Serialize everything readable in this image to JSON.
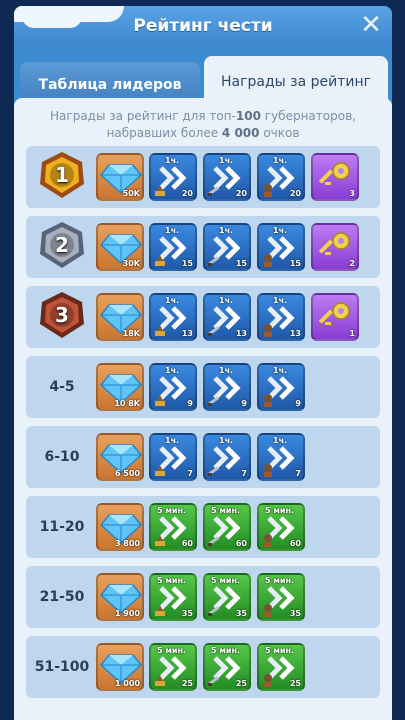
{
  "window": {
    "title": "Рейтинг чести",
    "close_icon": "close-icon"
  },
  "tabs": [
    {
      "label": "Таблица лидеров",
      "active": false
    },
    {
      "label": "Награды за рейтинг",
      "active": true
    }
  ],
  "intro": {
    "line1_prefix": "Награды за рейтинг для топ-",
    "line1_bold": "100",
    "line1_suffix": " губернаторов,",
    "line2_prefix": "набравших более ",
    "line2_bold": "4 000",
    "line2_suffix": " очков"
  },
  "rows": [
    {
      "rank": "1",
      "rank_icon": "gold-badge-icon",
      "gems": "50K",
      "boosts": [
        {
          "time": "1ч.",
          "qty": "20",
          "kind": "construction"
        },
        {
          "time": "1ч.",
          "qty": "20",
          "kind": "training"
        },
        {
          "time": "1ч.",
          "qty": "20",
          "kind": "research"
        }
      ],
      "key": "3"
    },
    {
      "rank": "2",
      "rank_icon": "silver-badge-icon",
      "gems": "30K",
      "boosts": [
        {
          "time": "1ч.",
          "qty": "15",
          "kind": "construction"
        },
        {
          "time": "1ч.",
          "qty": "15",
          "kind": "training"
        },
        {
          "time": "1ч.",
          "qty": "15",
          "kind": "research"
        }
      ],
      "key": "2"
    },
    {
      "rank": "3",
      "rank_icon": "bronze-badge-icon",
      "gems": "18K",
      "boosts": [
        {
          "time": "1ч.",
          "qty": "13",
          "kind": "construction"
        },
        {
          "time": "1ч.",
          "qty": "13",
          "kind": "training"
        },
        {
          "time": "1ч.",
          "qty": "13",
          "kind": "research"
        }
      ],
      "key": "1"
    },
    {
      "rank": "4-5",
      "gems": "10 8K",
      "boosts": [
        {
          "time": "1ч.",
          "qty": "9",
          "kind": "construction"
        },
        {
          "time": "1ч.",
          "qty": "9",
          "kind": "training"
        },
        {
          "time": "1ч.",
          "qty": "9",
          "kind": "research"
        }
      ]
    },
    {
      "rank": "6-10",
      "gems": "6 500",
      "boosts": [
        {
          "time": "1ч.",
          "qty": "7",
          "kind": "construction"
        },
        {
          "time": "1ч.",
          "qty": "7",
          "kind": "training"
        },
        {
          "time": "1ч.",
          "qty": "7",
          "kind": "research"
        }
      ]
    },
    {
      "rank": "11-20",
      "gems": "3 800",
      "boosts": [
        {
          "time": "5 мин.",
          "qty": "60",
          "kind": "construction"
        },
        {
          "time": "5 мин.",
          "qty": "60",
          "kind": "training"
        },
        {
          "time": "5 мин.",
          "qty": "60",
          "kind": "research"
        }
      ]
    },
    {
      "rank": "21-50",
      "gems": "1 900",
      "boosts": [
        {
          "time": "5 мин.",
          "qty": "35",
          "kind": "construction"
        },
        {
          "time": "5 мин.",
          "qty": "35",
          "kind": "training"
        },
        {
          "time": "5 мин.",
          "qty": "35",
          "kind": "research"
        }
      ]
    },
    {
      "rank": "51-100",
      "gems": "1 000",
      "boosts": [
        {
          "time": "5 мин.",
          "qty": "25",
          "kind": "construction"
        },
        {
          "time": "5 мин.",
          "qty": "25",
          "kind": "training"
        },
        {
          "time": "5 мин.",
          "qty": "25",
          "kind": "research"
        }
      ]
    }
  ],
  "colors": {
    "gold": "#e8a42a",
    "silver": "#8e96a8",
    "bronze": "#b0502f",
    "gem_tile": "#d38840",
    "hour_boost_tile": "#2f74c8",
    "minute_boost_tile": "#3aa83a",
    "key_tile": "#a65ae4"
  }
}
